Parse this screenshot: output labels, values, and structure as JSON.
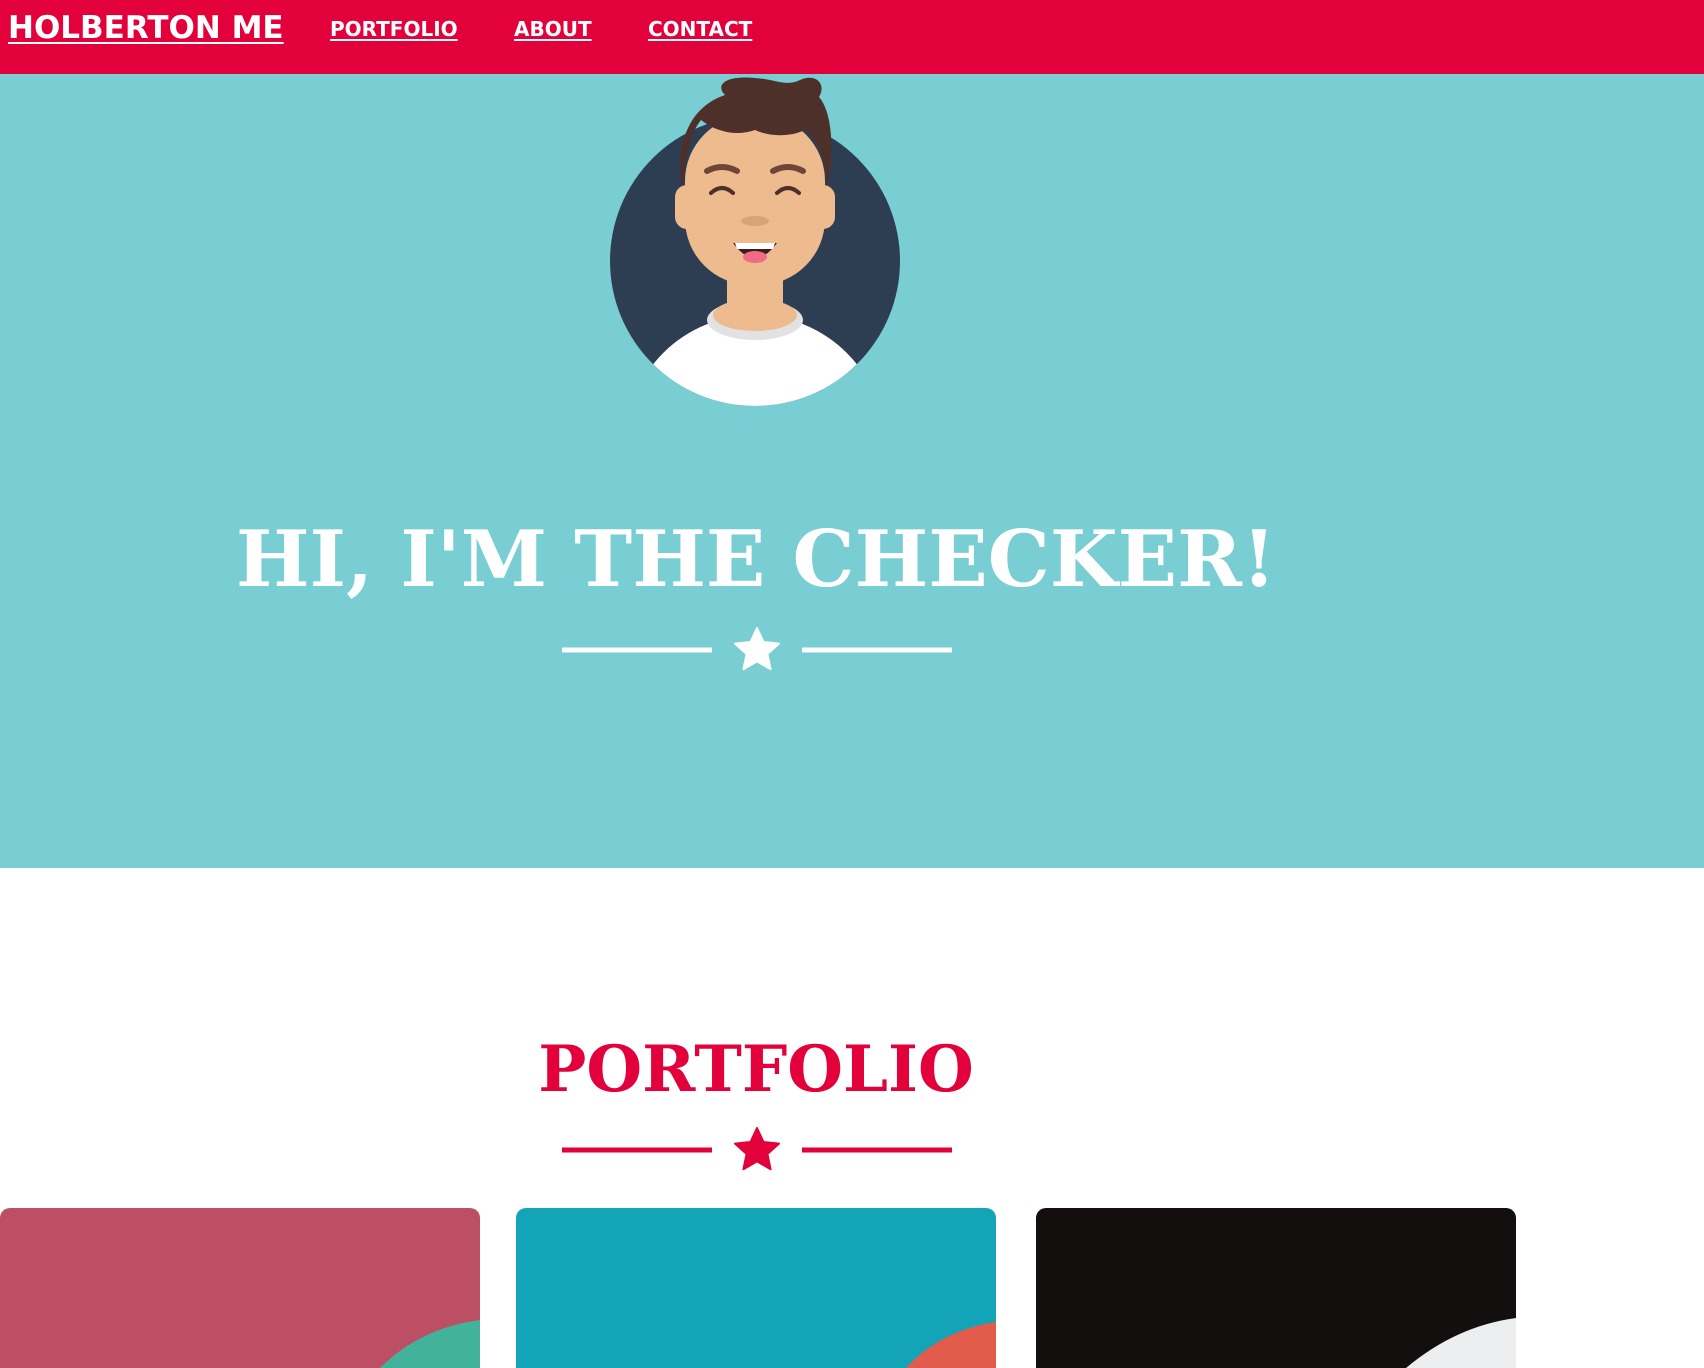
{
  "nav": {
    "brand": "HOLBERTON ME",
    "links": [
      {
        "label": "PORTFOLIO"
      },
      {
        "label": "ABOUT"
      },
      {
        "label": "CONTACT"
      }
    ]
  },
  "hero": {
    "avatar_icon": "smiling-man-avatar",
    "title": "HI, I'M THE CHECKER!",
    "divider_icon": "star-icon"
  },
  "portfolio": {
    "title": "PORTFOLIO",
    "divider_icon": "star-icon",
    "cards": [
      {
        "name": "portfolio-card-1",
        "color": "#bc4f64",
        "accent": "#43b29b"
      },
      {
        "name": "portfolio-card-2",
        "color": "#14a4b7",
        "accent": "#e35b4b"
      },
      {
        "name": "portfolio-card-3",
        "color": "#130f0e",
        "accent": "#eceeef"
      }
    ]
  },
  "colors": {
    "brand_red": "#e2013a",
    "hero_teal": "#78ced2",
    "avatar_bg": "#2e3e52"
  }
}
